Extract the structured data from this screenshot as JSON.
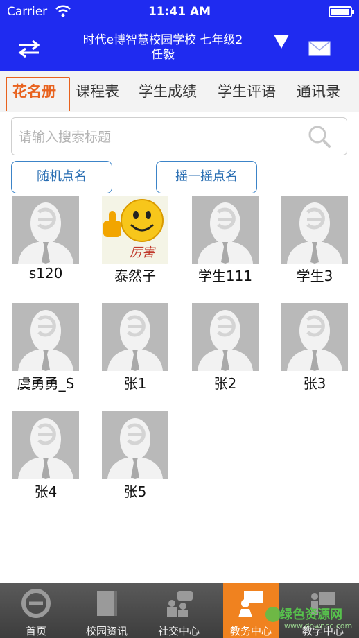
{
  "status_bar": {
    "carrier": "Carrier",
    "time": "11:41 AM"
  },
  "header": {
    "title_line1": "时代e博智慧校园学校 七年级2",
    "title_line2": "任毅",
    "switch_icon": "swap-arrows-icon",
    "dropdown_icon": "triangle-down-icon",
    "mail_icon": "mail-icon"
  },
  "tabs": [
    {
      "label": "花名册",
      "active": true
    },
    {
      "label": "课程表"
    },
    {
      "label": "学生成绩"
    },
    {
      "label": "学生评语"
    },
    {
      "label": "通讯录"
    }
  ],
  "search": {
    "placeholder": "请输入搜索标题",
    "icon": "search-icon"
  },
  "buttons": {
    "random_roll": "随机点名",
    "shake_roll": "摇一摇点名"
  },
  "students": [
    {
      "name": "s120",
      "avatar": "default"
    },
    {
      "name": "泰然子",
      "avatar": "thumbs-up-smiley",
      "avatar_caption": "厉害"
    },
    {
      "name": "学生111",
      "avatar": "default"
    },
    {
      "name": "学生3",
      "avatar": "default"
    },
    {
      "name": "虞勇勇_S",
      "avatar": "default"
    },
    {
      "name": "张1",
      "avatar": "default"
    },
    {
      "name": "张2",
      "avatar": "default"
    },
    {
      "name": "张3",
      "avatar": "default"
    },
    {
      "name": "张4",
      "avatar": "default"
    },
    {
      "name": "张5",
      "avatar": "default"
    }
  ],
  "tabbar": [
    {
      "label": "首页",
      "icon": "e-logo-icon"
    },
    {
      "label": "校园资讯",
      "icon": "book-icon"
    },
    {
      "label": "社交中心",
      "icon": "people-chat-icon"
    },
    {
      "label": "教务中心",
      "icon": "teacher-icon",
      "active": true
    },
    {
      "label": "教学中心",
      "icon": "lecture-icon"
    }
  ],
  "watermark": {
    "text": "绿色资源网",
    "sub": "www.downcc.com"
  },
  "colors": {
    "header": "#1f2bf0",
    "accent": "#e8621e",
    "button_border": "#3c84c8",
    "tabbar_active": "#f0821f"
  }
}
